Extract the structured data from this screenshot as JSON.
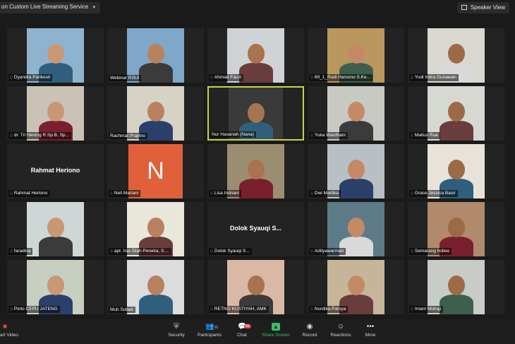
{
  "window": {
    "title": "on Custom Live Streaming Service",
    "speaker_view": "Speaker View"
  },
  "participants": [
    {
      "name": "Dyandra Parikesit",
      "muted": true
    },
    {
      "name": "Webinar RSUI",
      "muted": false
    },
    {
      "name": "Ahmad Fauzi",
      "muted": true
    },
    {
      "name": "69_1_Rudi Harsono S.Ke...",
      "muted": true
    },
    {
      "name": "Yudi Indra Gunawan",
      "muted": true
    },
    {
      "name": "dr. Tri Hening R.Sp.B, Sp...",
      "muted": true
    },
    {
      "name": "Rachmat Prajitno",
      "muted": false
    },
    {
      "name": "Nur Hasanah (Nana)",
      "muted": false
    },
    {
      "name": "Yuka Wardhani",
      "muted": true
    },
    {
      "name": "Matius Rua",
      "muted": true
    },
    {
      "name": "Rahmat Heriono",
      "muted": true
    },
    {
      "name": "Neli Mariani",
      "muted": true
    },
    {
      "name": "Lisa Indriani",
      "muted": true
    },
    {
      "name": "Dwi Martika",
      "muted": true
    },
    {
      "name": "Grace Jessica Basir",
      "muted": true
    },
    {
      "name": "faradina",
      "muted": true
    },
    {
      "name": "apt. Iras Diah Perwira, S....",
      "muted": true
    },
    {
      "name": "Dolok Syauqi S...",
      "muted": true
    },
    {
      "name": "Adityawarman",
      "muted": true
    },
    {
      "name": "Semarang hollee",
      "muted": true
    },
    {
      "name": "Pinto CEPU JATENG",
      "muted": true
    },
    {
      "name": "Muh Subair",
      "muted": false
    },
    {
      "name": "RETNO KUSTIYAH, AMK",
      "muted": true
    },
    {
      "name": "Nurdika Parsya",
      "muted": true
    },
    {
      "name": "Imam Muhaji",
      "muted": true
    }
  ],
  "tile_labels": {
    "rahmat": "Rahmat Heriono",
    "dolok": "Dolok Syauqi S...",
    "neli_initial": "N"
  },
  "toolbar": {
    "start_video": "art Video",
    "security": "Security",
    "participants": "Participants",
    "participants_count": "91",
    "chat": "Chat",
    "chat_badge": "96",
    "share_screen": "Share Screen",
    "record": "Record",
    "reactions": "Reactions",
    "more": "More"
  },
  "colors": {
    "active_speaker_border": "#c8d445",
    "share_green": "#38c163",
    "muted_red": "#e0463f",
    "avatar_orange": "#e0603a"
  }
}
